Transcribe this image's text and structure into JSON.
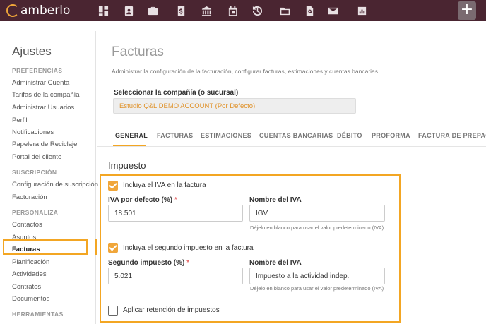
{
  "app": {
    "brand": "amberlo",
    "accent": "#f3a623",
    "topbar_color": "#4a2531"
  },
  "topbar": {
    "icons": [
      "dashboard-icon",
      "contacts-icon",
      "briefcase-icon",
      "billing-icon",
      "bank-icon",
      "calendar-icon",
      "timer-icon",
      "folder-icon",
      "file-search-icon",
      "mail-icon",
      "reports-icon"
    ],
    "add_label": "+"
  },
  "sidebar": {
    "title": "Ajustes",
    "sections": [
      {
        "label": "PREFERENCIAS",
        "items": [
          "Administrar Cuenta",
          "Tarifas de la compañía",
          "Administrar Usuarios",
          "Perfil",
          "Notificaciones",
          "Papelera de Reciclaje",
          "Portal del cliente"
        ]
      },
      {
        "label": "SUSCRIPCIÓN",
        "items": [
          "Configuración de suscripción",
          "Facturación"
        ]
      },
      {
        "label": "PERSONALIZA",
        "items": [
          "Contactos",
          "Asuntos",
          "Facturas",
          "Planificación",
          "Actividades",
          "Contratos",
          "Documentos"
        ]
      },
      {
        "label": "HERRAMIENTAS",
        "items": []
      }
    ],
    "active_item": "Facturas"
  },
  "main": {
    "title": "Facturas",
    "subtitle": "Administrar la configuración de la facturación, configurar facturas, estimaciones y cuentas bancarias",
    "company_label": "Seleccionar la compañía (o sucursal)",
    "company_value": "Estudio Q&L DEMO ACCOUNT (Por Defecto)",
    "tabs": [
      "GENERAL",
      "FACTURAS",
      "ESTIMACIONES",
      "CUENTAS BANCARIAS",
      "DÉBITO",
      "PROFORMA",
      "FACTURA DE PREPAGO"
    ],
    "active_tab": "GENERAL",
    "section_title": "Impuesto",
    "tax1": {
      "checkbox_label": "Incluya el IVA en la factura",
      "checked": true,
      "rate_label": "IVA por defecto (%)",
      "rate_value": "18.501",
      "name_label": "Nombre del IVA",
      "name_value": "IGV",
      "hint": "Déjelo en blanco para usar el valor predeterminado (IVA)"
    },
    "tax2": {
      "checkbox_label": "Incluya el segundo impuesto en la factura",
      "checked": true,
      "rate_label": "Segundo impuesto (%)",
      "rate_value": "5.021",
      "name_label": "Nombre del IVA",
      "name_value": "Impuesto a la actividad indep.",
      "hint": "Déjelo en blanco para usar el valor predeterminado (IVA)"
    },
    "withholding": {
      "checkbox_label": "Aplicar retención de impuestos",
      "checked": false
    },
    "required_mark": "*"
  }
}
